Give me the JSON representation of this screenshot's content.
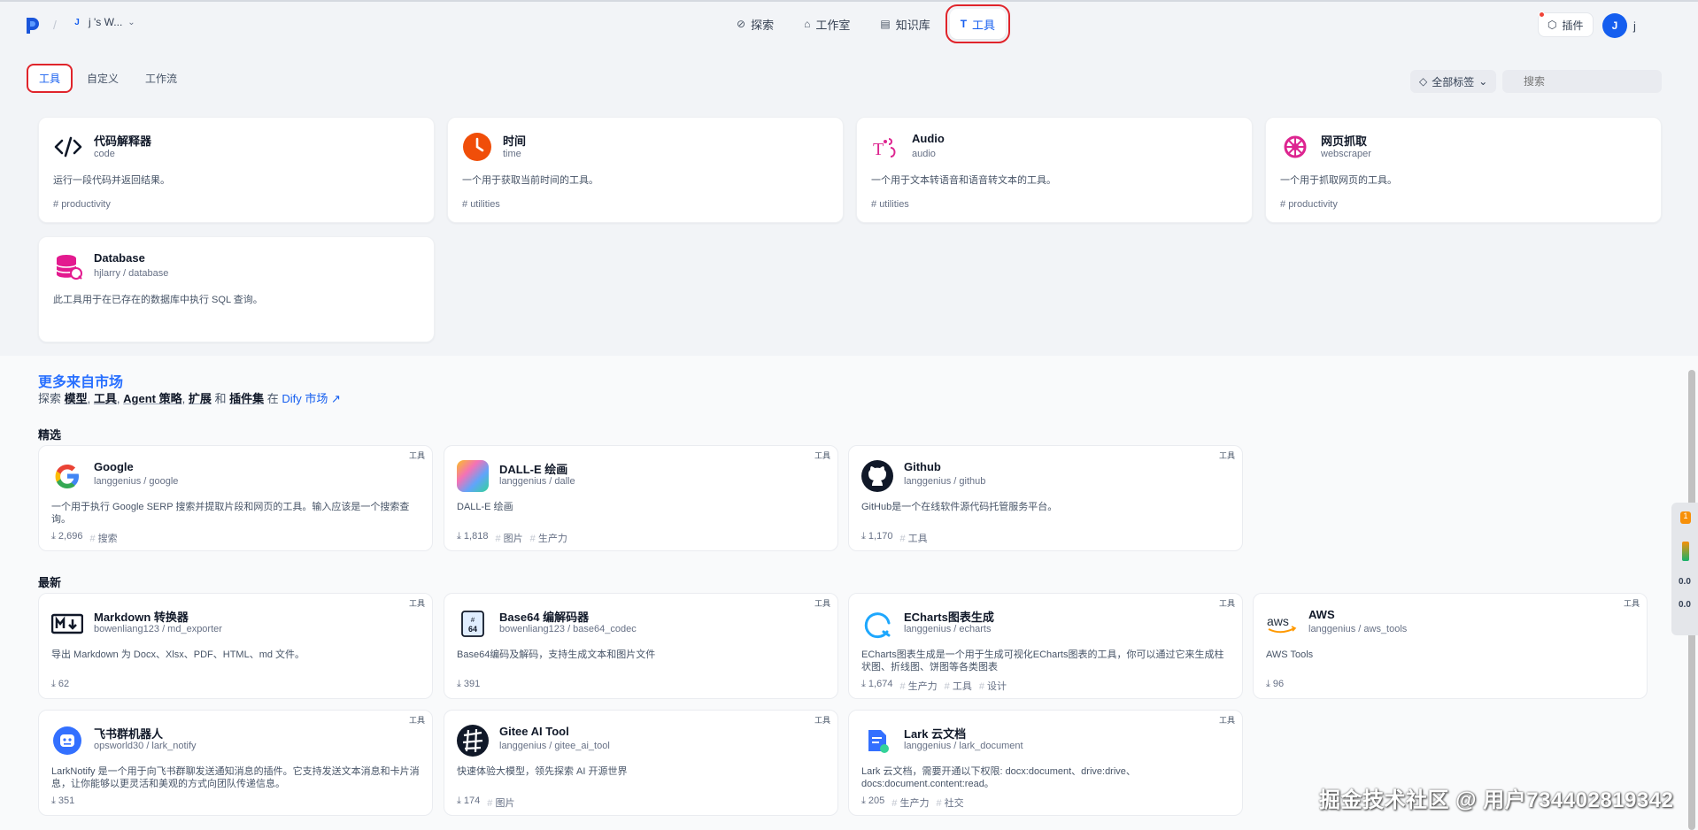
{
  "header": {
    "workspace": "j   's W...",
    "nav": [
      {
        "label": "探索",
        "icon": "compass-icon",
        "glyph": "⊘"
      },
      {
        "label": "工作室",
        "icon": "robot-icon",
        "glyph": "⌂"
      },
      {
        "label": "知识库",
        "icon": "book-icon",
        "glyph": "▤"
      },
      {
        "label": "工具",
        "icon": "tool-icon",
        "glyph": "T"
      }
    ],
    "plugins_label": "插件",
    "avatar_letter": "J",
    "user_name": "j"
  },
  "tools": {
    "tabs": [
      "工具",
      "自定义",
      "工作流"
    ],
    "filter_label": "全部标签",
    "search_placeholder": "搜索",
    "cards": [
      {
        "name": "代码解释器",
        "sub": "code",
        "desc": "运行一段代码并返回结果。",
        "tag": "productivity"
      },
      {
        "name": "时间",
        "sub": "time",
        "desc": "一个用于获取当前时间的工具。",
        "tag": "utilities"
      },
      {
        "name": "Audio",
        "sub": "audio",
        "desc": "一个用于文本转语音和语音转文本的工具。",
        "tag": "utilities"
      },
      {
        "name": "网页抓取",
        "sub": "webscraper",
        "desc": "一个用于抓取网页的工具。",
        "tag": "productivity"
      },
      {
        "name": "Database",
        "sub": "hjlarry / database",
        "desc": "此工具用于在已存在的数据库中执行 SQL 查询。",
        "tag": ""
      }
    ]
  },
  "market": {
    "title": "更多来自市场",
    "subtitle_prefix": "探索",
    "subtitle_items": [
      "模型",
      "工具",
      "Agent 策略",
      "扩展",
      "插件集"
    ],
    "subtitle_and": "和",
    "subtitle_in": "在",
    "dify_link": "Dify 市场 ↗",
    "featured_label": "精选",
    "latest_label": "最新",
    "badge": "工具",
    "featured": [
      {
        "name": "Google",
        "sub": "langgenius / google",
        "desc": "一个用于执行 Google SERP 搜索并提取片段和网页的工具。输入应该是一个搜索查询。",
        "downloads": "2,696",
        "tags": [
          "搜索"
        ]
      },
      {
        "name": "DALL-E 绘画",
        "sub": "langgenius / dalle",
        "desc": "DALL-E 绘画",
        "downloads": "1,818",
        "tags": [
          "图片",
          "生产力"
        ]
      },
      {
        "name": "Github",
        "sub": "langgenius / github",
        "desc": "GitHub是一个在线软件源代码托管服务平台。",
        "downloads": "1,170",
        "tags": [
          "工具"
        ]
      }
    ],
    "latest": [
      {
        "name": "Markdown 转换器",
        "sub": "bowenliang123 / md_exporter",
        "desc": "导出 Markdown 为 Docx、Xlsx、PDF、HTML、md 文件。",
        "downloads": "62",
        "tags": []
      },
      {
        "name": "Base64 编解码器",
        "sub": "bowenliang123 / base64_codec",
        "desc": "Base64编码及解码，支持生成文本和图片文件",
        "downloads": "391",
        "tags": []
      },
      {
        "name": "ECharts图表生成",
        "sub": "langgenius / echarts",
        "desc": "ECharts图表生成是一个用于生成可视化ECharts图表的工具，你可以通过它来生成柱状图、折线图、饼图等各类图表",
        "downloads": "1,674",
        "tags": [
          "生产力",
          "工具",
          "设计"
        ]
      },
      {
        "name": "AWS",
        "sub": "langgenius / aws_tools",
        "desc": "AWS Tools",
        "downloads": "96",
        "tags": []
      },
      {
        "name": "飞书群机器人",
        "sub": "opsworld30 / lark_notify",
        "desc": "LarkNotify 是一个用于向飞书群聊发送通知消息的插件。它支持发送文本消息和卡片消息，让你能够以更灵活和美观的方式向团队传递信息。",
        "downloads": "351",
        "tags": []
      },
      {
        "name": "Gitee AI Tool",
        "sub": "langgenius / gitee_ai_tool",
        "desc": "快速体验大模型，领先探索 AI 开源世界",
        "downloads": "174",
        "tags": [
          "图片"
        ]
      },
      {
        "name": "Lark 云文档",
        "sub": "langgenius / lark_document",
        "desc": "Lark 云文档，需要开通以下权限: docx:document、drive:drive、docs:document.content:read。",
        "downloads": "205",
        "tags": [
          "生产力",
          "社交"
        ]
      }
    ]
  },
  "side_widget": {
    "badge": "1",
    "up": "0.0",
    "down": "0.0"
  },
  "watermark": "掘金技术社区 @ 用户734402819342"
}
